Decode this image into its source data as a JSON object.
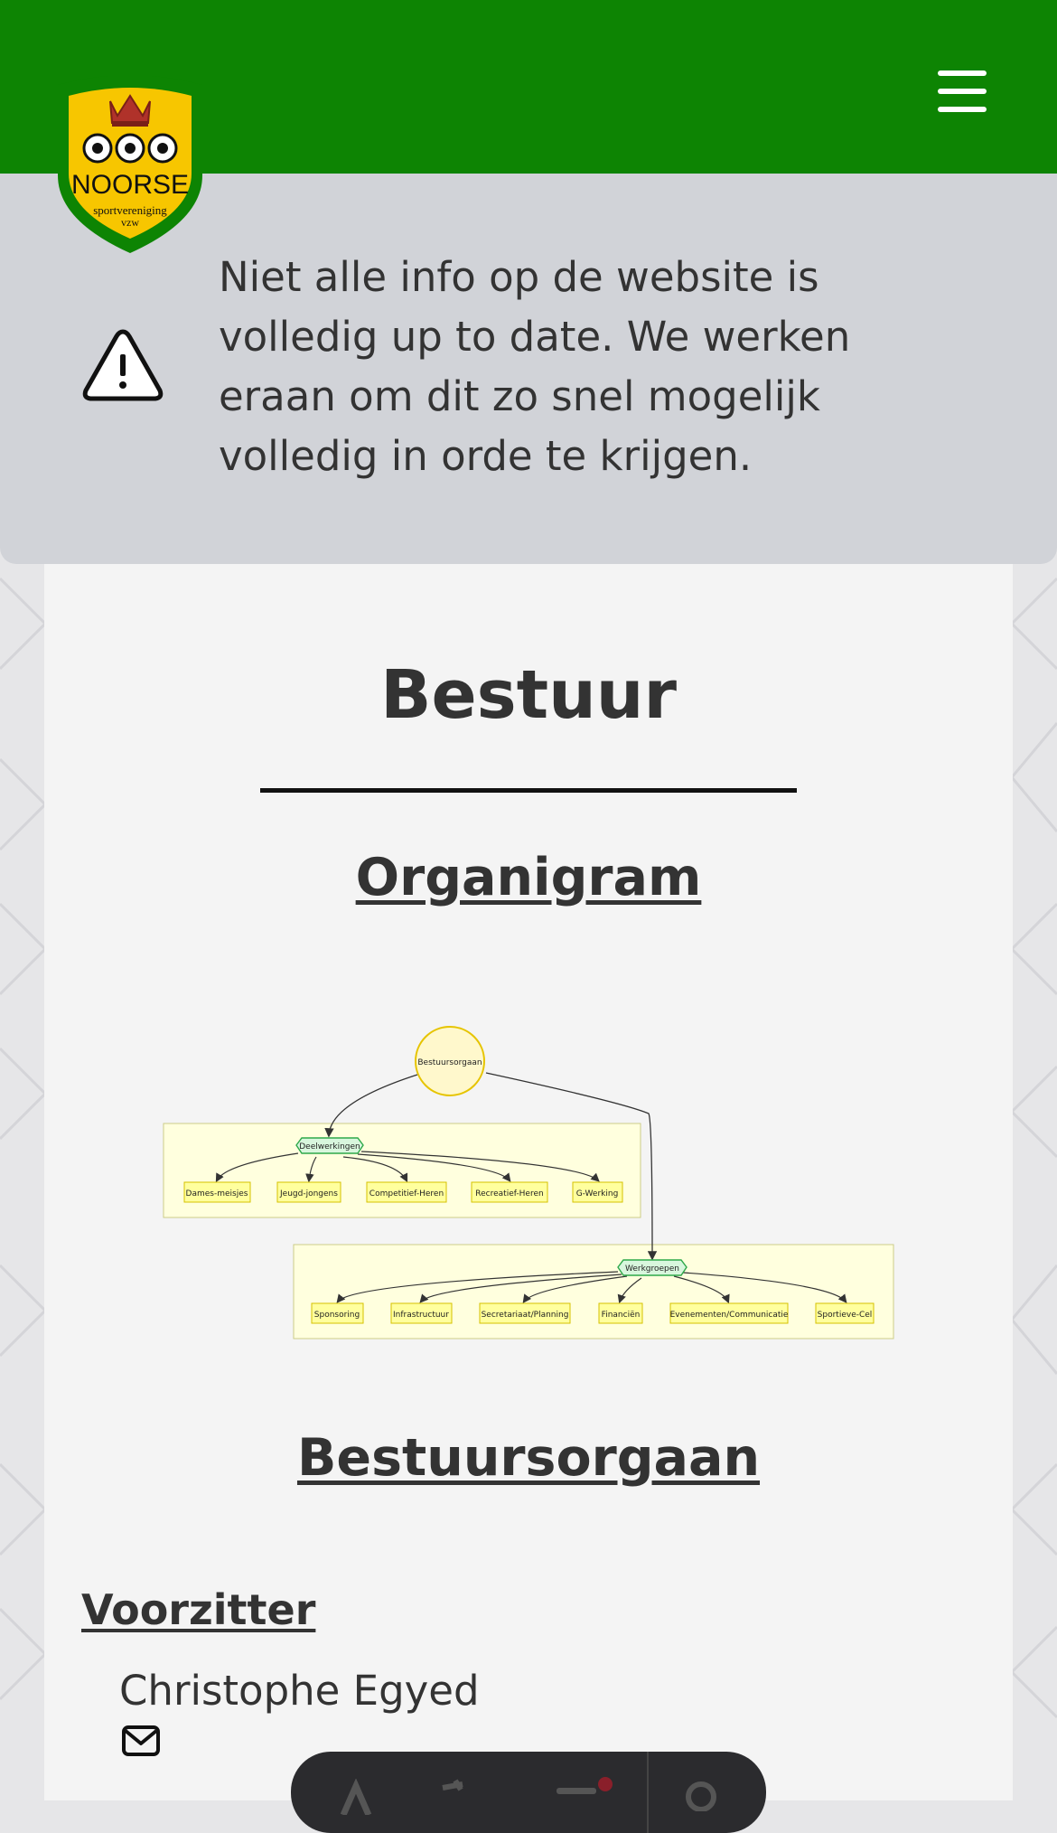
{
  "notice": {
    "text": "Niet alle info op de website is volledig up to date. We werken eraan om dit zo snel mogelijk volledig in orde te krijgen."
  },
  "logo": {
    "text": "NOORSE",
    "subtext_line1": "sportvereniging",
    "subtext_line2": "vzw"
  },
  "page": {
    "title": "Bestuur"
  },
  "sections": {
    "organigram_heading": "Organigram",
    "bestuursorgaan_heading": "Bestuursorgaan"
  },
  "organigram": {
    "root": "Bestuursorgaan",
    "deelwerkingen": {
      "label": "Deelwerkingen",
      "items": [
        "Dames-meisjes",
        "Jeugd-jongens",
        "Competitief-Heren",
        "Recreatief-Heren",
        "G-Werking"
      ]
    },
    "werkgroepen": {
      "label": "Werkgroepen",
      "items": [
        "Sponsoring",
        "Infrastructuur",
        "Secretariaat/Planning",
        "Financiën",
        "Evenementen/Communicatie",
        "Sportieve-Cel"
      ]
    }
  },
  "roles": [
    {
      "title": "Voorzitter",
      "name": "Christophe Egyed"
    }
  ],
  "colors": {
    "header_green": "#0d8403",
    "notice_bg": "#d1d3d8",
    "card_bg": "#f4f4f4",
    "cluster_fill": "#ffffde",
    "node_fill": "#ffff9e",
    "hex_fill": "#d8f6dd",
    "root_fill": "#fff8cc"
  },
  "icons": {
    "menu": "hamburger-menu-icon",
    "warning": "warning-triangle-icon",
    "mail": "envelope-icon"
  }
}
